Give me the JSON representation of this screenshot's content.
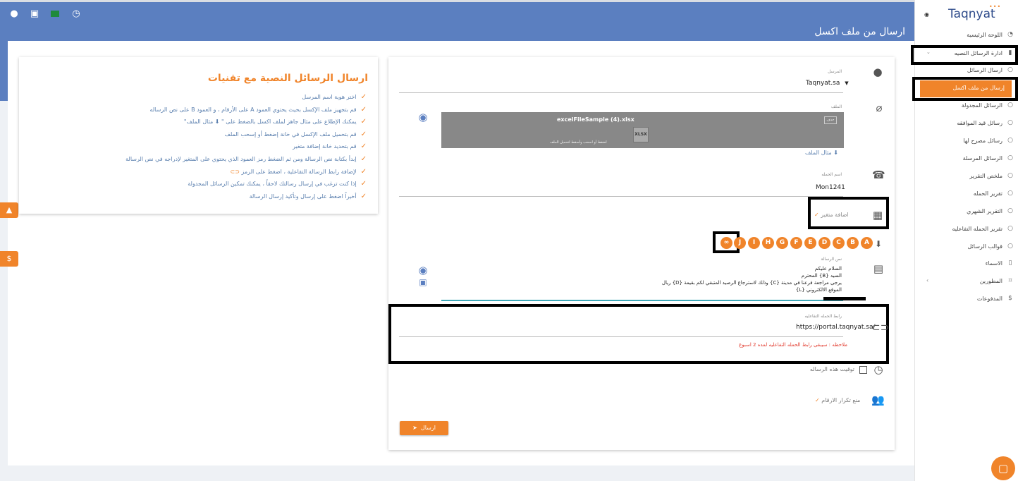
{
  "header": {
    "title": "ارسال من ملف اكسل",
    "icons": [
      "user-circle-icon",
      "excel-icon",
      "saudi-flag-icon",
      "clock-icon"
    ]
  },
  "info": {
    "title": "ارسال الرسائل النصية مع تقنيات",
    "items": [
      "اختر هوية اسم المرسل",
      "قم بتجهيز ملف الإكسل بحيث يحتوي العمود A على الأرقام ، و العمود B على نص الرساله",
      "يمكنك الإطلاع على مثال جاهز لملف اكسل بالضغط على \" ⬇ مثال الملف\"",
      "قم بتحميل ملف الإكسل في خانة إضغط أو إسحب الملف",
      "قم بتحديد خانة إضافة متغير",
      "إبدأ بكتابة نص الرسالة ومن ثم الضغط رمز العمود الذي يحتوي على المتغير لإدراجه في نص الرسالة",
      "لإضافة رابط الرسالة التفاعلية ، اضغط على الرمز",
      "إذا كنت ترغب في إرسال رسالتك لاحقاً ، يمكنك تمكين الرسائل المجدولة",
      "أخيراً اضغط على إرسال وتأكيد إرسال الرسالة"
    ]
  },
  "form": {
    "sender_label": "المرسل",
    "sender_value": "Taqnyat.sa",
    "file_label": "الملف",
    "file_name": "excelFileSample (4).xlsx",
    "file_hint": "اضغط أو اسحب وأسقط لتحميل الملف",
    "file_button": "حذف",
    "file_type": "XLSX",
    "sample_link": "مثال الملف",
    "campaign_label": "اسم الحمله",
    "campaign_value": "Mon1241",
    "add_variable": "اضافة متغير",
    "columns": [
      "A",
      "B",
      "C",
      "D",
      "E",
      "F",
      "G",
      "H",
      "I",
      "J"
    ],
    "message_label": "نص الرسالة",
    "message_lines": [
      "السلام عليكم",
      "السيد {B} المحترم",
      "يرجى مراجعة فرعنا في مدينة {C} وذلك لاسترجاع الرصيد المتبقي لكم بقيمة {D} ريال",
      "الموقع الالكتروني {L}"
    ],
    "interactive_label": "رابط الحمله التفاعليه",
    "interactive_value": "https://portal.taqnyat.sa/",
    "interactive_note": "ملاحظه : سيبقى رابط الحمله التفاعليه لمده 2 اسبوع",
    "schedule_label": "توقيت هذه الرساله",
    "dedupe_label": "منع تكرار الارقام",
    "send_label": "ارسال"
  },
  "sidebar": {
    "logo": "Taqnyat",
    "items": [
      {
        "label": "اللوحة الرئيسية",
        "icon": "dashboard-icon"
      },
      {
        "label": "ادارة الرسائل النصيه",
        "icon": "bookmark-icon"
      },
      {
        "label": "ارسال الرسائل",
        "icon": "circle-icon"
      },
      {
        "label": "إرسال من ملف اكسل",
        "icon": "circle-icon"
      },
      {
        "label": "الرسائل المجدولة",
        "icon": "circle-icon"
      },
      {
        "label": "رسائل قيد الموافقه",
        "icon": "circle-icon"
      },
      {
        "label": "رسائل مصرح لها",
        "icon": "circle-icon"
      },
      {
        "label": "الرسائل المرسلة",
        "icon": "circle-icon"
      },
      {
        "label": "ملخص التقرير",
        "icon": "circle-icon"
      },
      {
        "label": "تقرير الحمله",
        "icon": "circle-icon"
      },
      {
        "label": "التقرير الشهري",
        "icon": "circle-icon"
      },
      {
        "label": "تقرير الحمله التفاعليه",
        "icon": "circle-icon"
      },
      {
        "label": "قوالب الرسائل",
        "icon": "circle-icon"
      },
      {
        "label": "الاسماء",
        "icon": "book-icon"
      },
      {
        "label": "المطورين",
        "icon": "code-icon"
      },
      {
        "label": "المدفوعات",
        "icon": "dollar-icon"
      }
    ]
  },
  "colors": {
    "accent": "#f0842a",
    "header": "#5b7fc0",
    "link": "#5a7fae"
  }
}
